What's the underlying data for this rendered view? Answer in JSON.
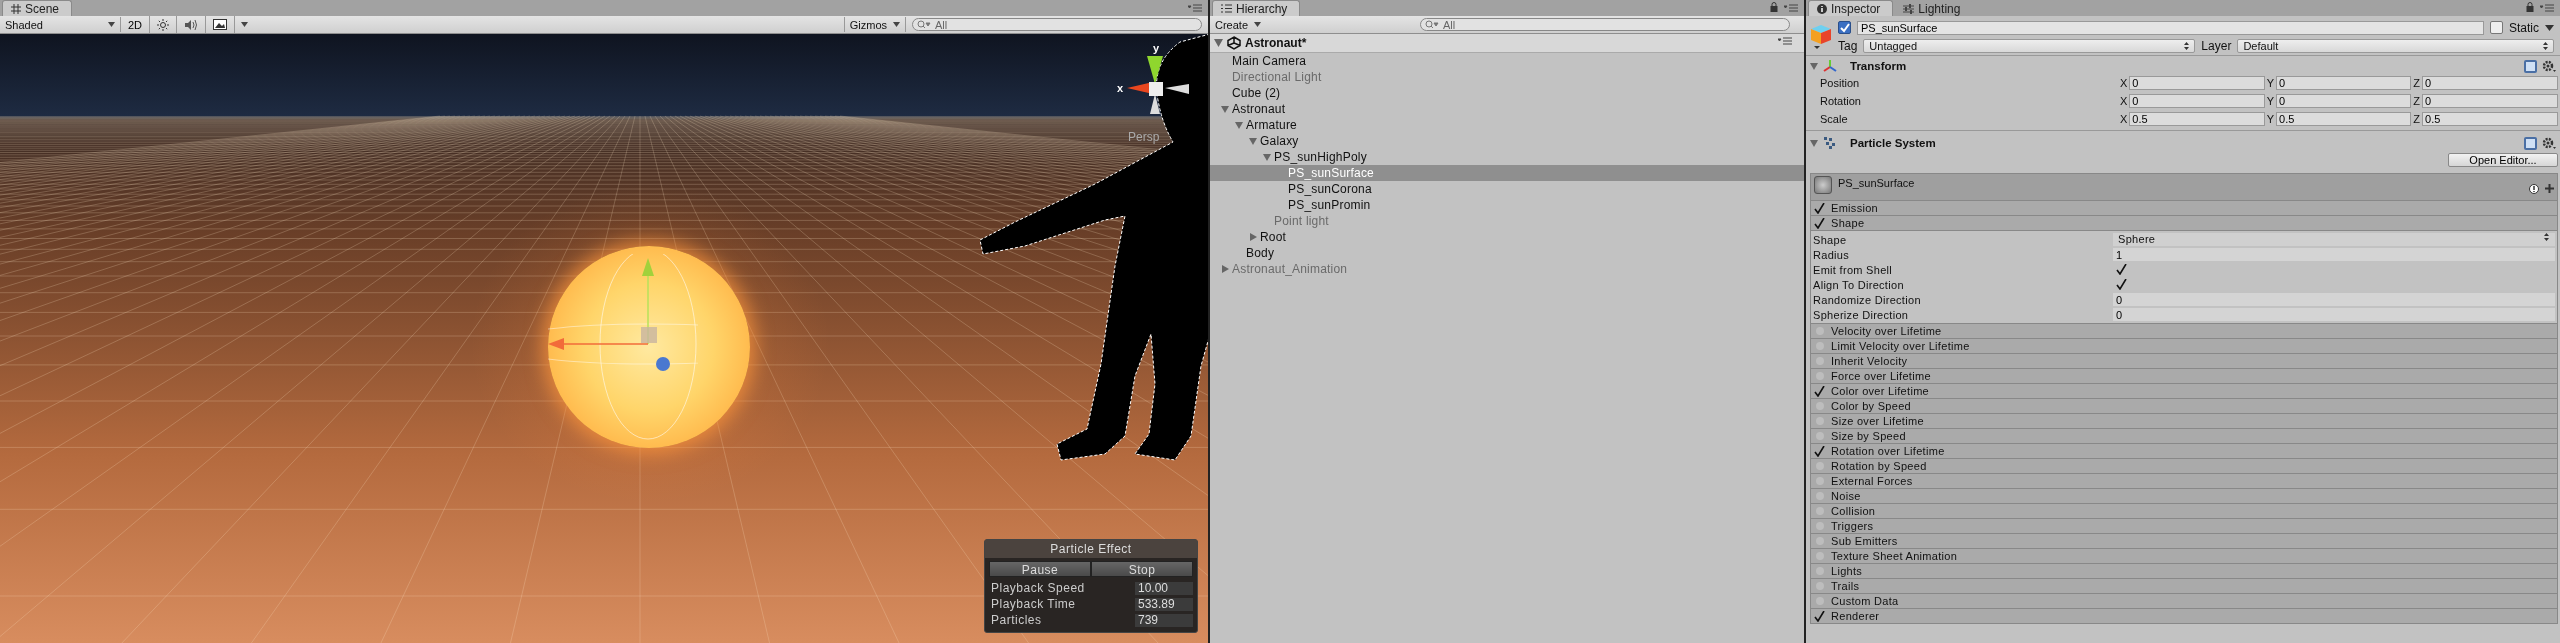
{
  "scene": {
    "tab": "Scene",
    "toolbar": {
      "shading": "Shaded",
      "mode_2d": "2D",
      "gizmos": "Gizmos",
      "search_placeholder": "All",
      "toggles": [
        {
          "kind": "lighting",
          "on": false
        },
        {
          "kind": "audio",
          "on": false
        },
        {
          "kind": "effects",
          "on": false
        }
      ]
    },
    "gizmo": {
      "x_label": "x",
      "y_label": "y",
      "projection": "Persp"
    },
    "particle_effect": {
      "title": "Particle Effect",
      "buttons": [
        "Pause",
        "Stop"
      ],
      "fields": [
        {
          "label": "Playback Speed",
          "value": "10.00"
        },
        {
          "label": "Playback Time",
          "value": "533.89"
        },
        {
          "label": "Particles",
          "value": "739"
        }
      ]
    }
  },
  "hierarchy": {
    "tab": "Hierarchy",
    "create": "Create",
    "search_placeholder": "All",
    "scene_name": "Astronaut*",
    "items": [
      {
        "label": "Main Camera",
        "inactive": false,
        "selected": false
      },
      {
        "label": "Directional Light",
        "inactive": true,
        "selected": false
      },
      {
        "label": "Cube (2)",
        "inactive": false,
        "selected": false
      },
      {
        "label": "Astronaut",
        "inactive": false,
        "selected": false,
        "expanded": true,
        "children": [
          {
            "label": "Armature",
            "inactive": false,
            "selected": false,
            "expanded": true,
            "children": [
              {
                "label": "Galaxy",
                "inactive": false,
                "selected": false,
                "expanded": true,
                "children": [
                  {
                    "label": "PS_sunHighPoly",
                    "inactive": false,
                    "selected": false,
                    "expanded": true,
                    "children": [
                      {
                        "label": "PS_sunSurface",
                        "inactive": false,
                        "selected": true
                      },
                      {
                        "label": "PS_sunCorona",
                        "inactive": false,
                        "selected": false
                      },
                      {
                        "label": "PS_sunPromin",
                        "inactive": false,
                        "selected": false
                      }
                    ]
                  },
                  {
                    "label": "Point light",
                    "inactive": true,
                    "selected": false
                  }
                ]
              },
              {
                "label": "Root",
                "inactive": false,
                "selected": false,
                "expanded": false
              }
            ]
          },
          {
            "label": "Body",
            "inactive": false,
            "selected": false
          }
        ]
      },
      {
        "label": "Astronaut_Animation",
        "inactive": true,
        "selected": false,
        "expanded": false
      }
    ]
  },
  "inspector": {
    "tabs": [
      {
        "label": "Inspector",
        "selected": true
      },
      {
        "label": "Lighting",
        "selected": false
      }
    ],
    "object": {
      "active": true,
      "name": "PS_sunSurface",
      "static_label": "Static",
      "static": false,
      "tag_label": "Tag",
      "tag": "Untagged",
      "layer_label": "Layer",
      "layer": "Default"
    },
    "transform": {
      "title": "Transform",
      "rows": [
        {
          "label": "Position",
          "values": [
            {
              "axis": "X",
              "value": "0"
            },
            {
              "axis": "Y",
              "value": "0"
            },
            {
              "axis": "Z",
              "value": "0"
            }
          ]
        },
        {
          "label": "Rotation",
          "values": [
            {
              "axis": "X",
              "value": "0"
            },
            {
              "axis": "Y",
              "value": "0"
            },
            {
              "axis": "Z",
              "value": "0"
            }
          ]
        },
        {
          "label": "Scale",
          "values": [
            {
              "axis": "X",
              "value": "0.5"
            },
            {
              "axis": "Y",
              "value": "0.5"
            },
            {
              "axis": "Z",
              "value": "0.5"
            }
          ]
        }
      ]
    },
    "particle_system": {
      "title": "Particle System",
      "open_editor": "Open Editor...",
      "system_name": "PS_sunSurface",
      "modules": [
        {
          "label": "Emission",
          "enabled": true
        },
        {
          "label": "Shape",
          "enabled": true,
          "properties": [
            {
              "label": "Shape",
              "kind": "dropdown",
              "value": "Sphere"
            },
            {
              "label": "Radius",
              "kind": "number",
              "value": "1"
            },
            {
              "label": "Emit from Shell",
              "kind": "checkbox",
              "checked": true
            },
            {
              "label": "Align To Direction",
              "kind": "checkbox",
              "checked": true
            },
            {
              "label": "Randomize Direction",
              "kind": "number",
              "value": "0"
            },
            {
              "label": "Spherize Direction",
              "kind": "number",
              "value": "0"
            }
          ]
        },
        {
          "label": "Velocity over Lifetime",
          "enabled": false
        },
        {
          "label": "Limit Velocity over Lifetime",
          "enabled": false
        },
        {
          "label": "Inherit Velocity",
          "enabled": false
        },
        {
          "label": "Force over Lifetime",
          "enabled": false
        },
        {
          "label": "Color over Lifetime",
          "enabled": true
        },
        {
          "label": "Color by Speed",
          "enabled": false
        },
        {
          "label": "Size over Lifetime",
          "enabled": false
        },
        {
          "label": "Size by Speed",
          "enabled": false
        },
        {
          "label": "Rotation over Lifetime",
          "enabled": true
        },
        {
          "label": "Rotation by Speed",
          "enabled": false
        },
        {
          "label": "External Forces",
          "enabled": false
        },
        {
          "label": "Noise",
          "enabled": false
        },
        {
          "label": "Collision",
          "enabled": false
        },
        {
          "label": "Triggers",
          "enabled": false
        },
        {
          "label": "Sub Emitters",
          "enabled": false
        },
        {
          "label": "Texture Sheet Animation",
          "enabled": false
        },
        {
          "label": "Lights",
          "enabled": false
        },
        {
          "label": "Trails",
          "enabled": false
        },
        {
          "label": "Custom Data",
          "enabled": false
        },
        {
          "label": "Renderer",
          "enabled": true
        }
      ]
    }
  }
}
